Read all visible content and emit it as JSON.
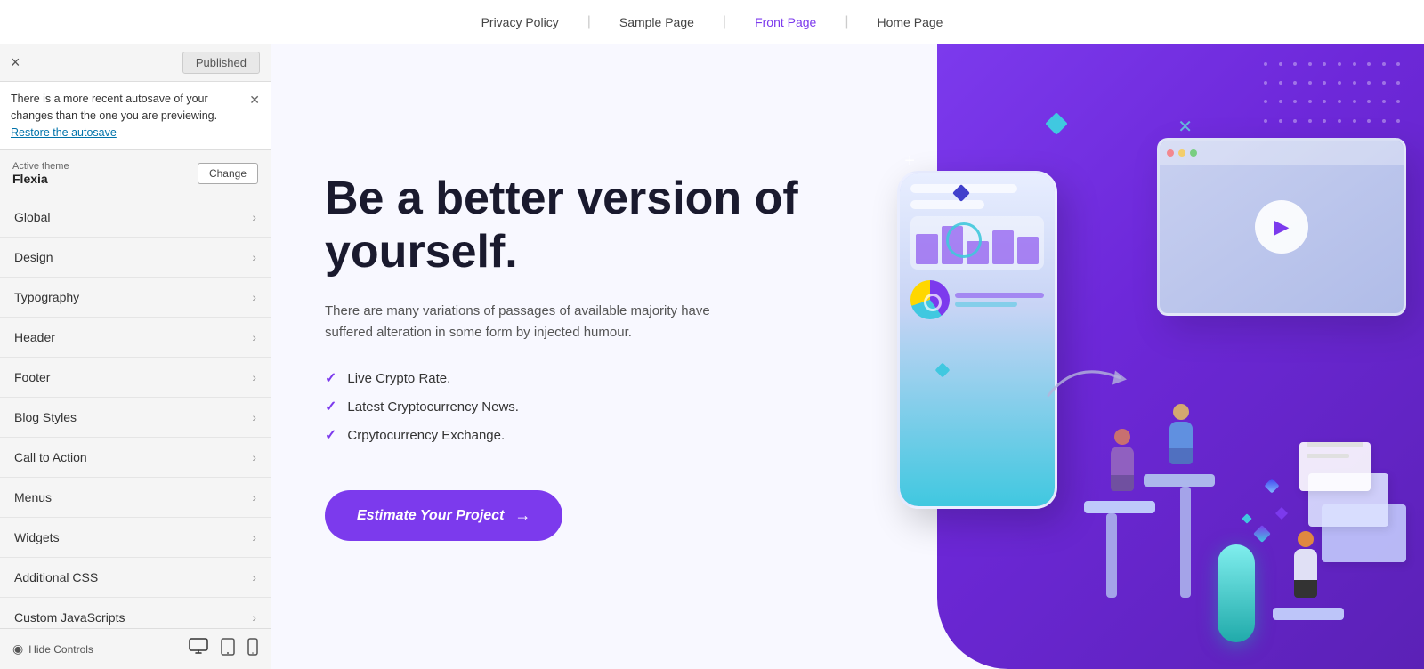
{
  "topNav": {
    "links": [
      {
        "label": "Privacy Policy",
        "active": false
      },
      {
        "label": "Sample Page",
        "active": false
      },
      {
        "label": "Front Page",
        "active": true
      },
      {
        "label": "Home Page",
        "active": false
      }
    ]
  },
  "leftPanel": {
    "closeLabel": "×",
    "statusLabel": "Published",
    "autosave": {
      "message": "There is a more recent autosave of your changes than the one you are previewing.",
      "restoreLabel": "Restore the autosave"
    },
    "theme": {
      "sectionLabel": "Active theme",
      "themeName": "Flexia",
      "changeLabel": "Change"
    },
    "menuItems": [
      {
        "label": "Global",
        "id": "global"
      },
      {
        "label": "Design",
        "id": "design"
      },
      {
        "label": "Typography",
        "id": "typography"
      },
      {
        "label": "Header",
        "id": "header"
      },
      {
        "label": "Footer",
        "id": "footer"
      },
      {
        "label": "Blog Styles",
        "id": "blog-styles"
      },
      {
        "label": "Call to Action",
        "id": "call-to-action"
      },
      {
        "label": "Menus",
        "id": "menus"
      },
      {
        "label": "Widgets",
        "id": "widgets"
      },
      {
        "label": "Additional CSS",
        "id": "additional-css"
      },
      {
        "label": "Custom JavaScripts",
        "id": "custom-js"
      }
    ],
    "bottom": {
      "hideLabel": "Hide Controls"
    }
  },
  "hero": {
    "title": "Be a better version of yourself.",
    "description": "There are many variations of passages of available majority have suffered alteration in some form by injected humour.",
    "features": [
      "Live Crypto Rate.",
      "Latest Cryptocurrency News.",
      "Crpytocurrency Exchange."
    ],
    "ctaLabel": "Estimate Your Project",
    "ctaArrow": "→"
  },
  "colors": {
    "accent": "#7c3aed",
    "accentDark": "#5b21b6",
    "navActive": "#7c3aed"
  }
}
